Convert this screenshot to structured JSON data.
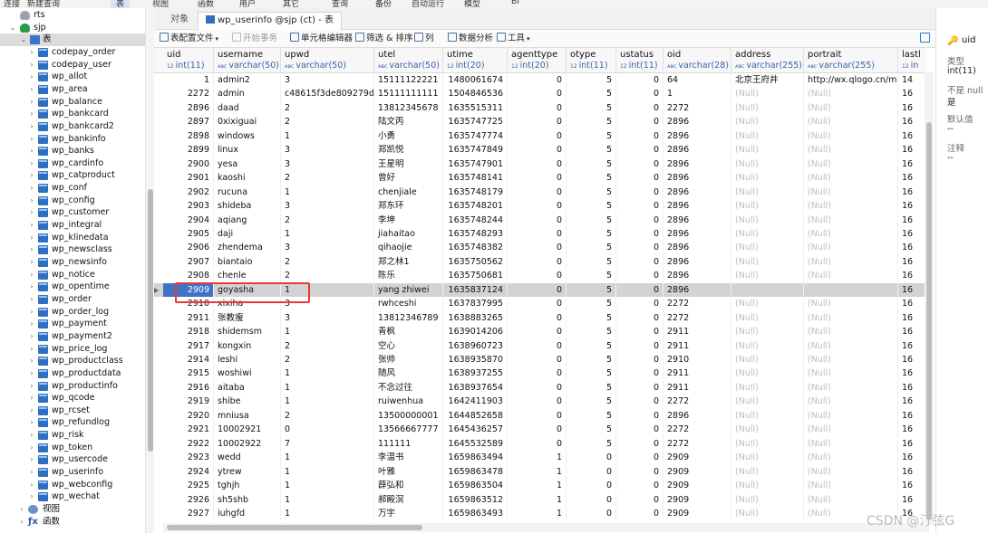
{
  "menubar": [
    "连接",
    "新建查询",
    "表",
    "视图",
    "函数",
    "用户",
    "其它",
    "查询",
    "备份",
    "自动运行",
    "模型",
    "BI"
  ],
  "sidebar": {
    "top_items": [
      {
        "label": "rts",
        "type": "db-closed"
      },
      {
        "label": "sjp",
        "type": "db-open"
      },
      {
        "label": "表",
        "type": "tables"
      }
    ],
    "tables": [
      "codepay_order",
      "codepay_user",
      "wp_allot",
      "wp_area",
      "wp_balance",
      "wp_bankcard",
      "wp_bankcard2",
      "wp_bankinfo",
      "wp_banks",
      "wp_cardinfo",
      "wp_catproduct",
      "wp_conf",
      "wp_config",
      "wp_customer",
      "wp_integral",
      "wp_klinedata",
      "wp_newsclass",
      "wp_newsinfo",
      "wp_notice",
      "wp_opentime",
      "wp_order",
      "wp_order_log",
      "wp_payment",
      "wp_payment2",
      "wp_price_log",
      "wp_productclass",
      "wp_productdata",
      "wp_productinfo",
      "wp_qcode",
      "wp_rcset",
      "wp_refundlog",
      "wp_risk",
      "wp_token",
      "wp_usercode",
      "wp_userinfo",
      "wp_webconfig",
      "wp_wechat"
    ],
    "bottom_items": [
      {
        "label": "视图",
        "type": "view"
      },
      {
        "label": "函数",
        "type": "fn"
      }
    ]
  },
  "tabs": [
    {
      "label": "对象"
    },
    {
      "label": "wp_userinfo @sjp (ct) - 表"
    }
  ],
  "toolbar": {
    "table_config": "表配置文件",
    "begin_tx": "开始事务",
    "cell_editor": "单元格编辑器",
    "filter_sort": "筛选 & 排序",
    "columns": "列",
    "data_analysis": "数据分析",
    "tools": "工具"
  },
  "columns": [
    {
      "name": "uid",
      "type": "int(11)"
    },
    {
      "name": "username",
      "type": "varchar(50)"
    },
    {
      "name": "upwd",
      "type": "varchar(50)"
    },
    {
      "name": "utel",
      "type": "varchar(50)"
    },
    {
      "name": "utime",
      "type": "int(20)"
    },
    {
      "name": "agenttype",
      "type": "int(20)"
    },
    {
      "name": "otype",
      "type": "int(11)"
    },
    {
      "name": "ustatus",
      "type": "int(11)"
    },
    {
      "name": "oid",
      "type": "varchar(28)"
    },
    {
      "name": "address",
      "type": "varchar(255)"
    },
    {
      "name": "portrait",
      "type": "varchar(255)"
    },
    {
      "name": "lastl",
      "type": "in"
    }
  ],
  "rows": [
    [
      "1",
      "admin2",
      "3",
      "15111122221",
      "1480061674",
      "0",
      "5",
      "0",
      "64",
      "北京王府井",
      "http://wx.qlogo.cn/mm",
      "14"
    ],
    [
      "2272",
      "admin",
      "c48615f3de809279d37e",
      "15111111111",
      "1504846536",
      "0",
      "5",
      "0",
      "1",
      "(Null)",
      "(Null)",
      "16"
    ],
    [
      "2896",
      "daad",
      "2",
      "13812345678",
      "1635515311",
      "0",
      "5",
      "0",
      "2272",
      "(Null)",
      "(Null)",
      "16"
    ],
    [
      "2897",
      "0xixiguai",
      "2",
      "陆文丙",
      "1635747725",
      "0",
      "5",
      "0",
      "2896",
      "(Null)",
      "(Null)",
      "16"
    ],
    [
      "2898",
      "windows",
      "1",
      "小勇",
      "1635747774",
      "0",
      "5",
      "0",
      "2896",
      "(Null)",
      "(Null)",
      "16"
    ],
    [
      "2899",
      "linux",
      "3",
      "郑凯悦",
      "1635747849",
      "0",
      "5",
      "0",
      "2896",
      "(Null)",
      "(Null)",
      "16"
    ],
    [
      "2900",
      "yesa",
      "3",
      "王星明",
      "1635747901",
      "0",
      "5",
      "0",
      "2896",
      "(Null)",
      "(Null)",
      "16"
    ],
    [
      "2901",
      "kaoshi",
      "2",
      "曾好",
      "1635748141",
      "0",
      "5",
      "0",
      "2896",
      "(Null)",
      "(Null)",
      "16"
    ],
    [
      "2902",
      "rucuna",
      "1",
      "chenjiale",
      "1635748179",
      "0",
      "5",
      "0",
      "2896",
      "(Null)",
      "(Null)",
      "16"
    ],
    [
      "2903",
      "shideba",
      "3",
      "郑东环",
      "1635748201",
      "0",
      "5",
      "0",
      "2896",
      "(Null)",
      "(Null)",
      "16"
    ],
    [
      "2904",
      "aqiang",
      "2",
      "李坤",
      "1635748244",
      "0",
      "5",
      "0",
      "2896",
      "(Null)",
      "(Null)",
      "16"
    ],
    [
      "2905",
      "daji",
      "1",
      "jiahaitao",
      "1635748293",
      "0",
      "5",
      "0",
      "2896",
      "(Null)",
      "(Null)",
      "16"
    ],
    [
      "2906",
      "zhendema",
      "3",
      "qihaojie",
      "1635748382",
      "0",
      "5",
      "0",
      "2896",
      "(Null)",
      "(Null)",
      "16"
    ],
    [
      "2907",
      "biantaio",
      "2",
      "郑之林1",
      "1635750562",
      "0",
      "5",
      "0",
      "2896",
      "(Null)",
      "(Null)",
      "16"
    ],
    [
      "2908",
      "chenle",
      "2",
      "陈乐",
      "1635750681",
      "0",
      "5",
      "0",
      "2896",
      "(Null)",
      "(Null)",
      "16"
    ],
    [
      "2909",
      "goyasha",
      "1",
      "yang zhiwei",
      "1635837124",
      "0",
      "5",
      "0",
      "2896",
      "",
      "",
      "16"
    ],
    [
      "2910",
      "xixiha",
      "3",
      "rwhceshi",
      "1637837995",
      "0",
      "5",
      "0",
      "2272",
      "(Null)",
      "(Null)",
      "16"
    ],
    [
      "2911",
      "张教瘦",
      "3",
      "13812346789",
      "1638883265",
      "0",
      "5",
      "0",
      "2272",
      "(Null)",
      "(Null)",
      "16"
    ],
    [
      "2918",
      "shidemsm",
      "1",
      "青枫",
      "1639014206",
      "0",
      "5",
      "0",
      "2911",
      "(Null)",
      "(Null)",
      "16"
    ],
    [
      "2917",
      "kongxin",
      "2",
      "空心",
      "1638960723",
      "0",
      "5",
      "0",
      "2911",
      "(Null)",
      "(Null)",
      "16"
    ],
    [
      "2914",
      "leshi",
      "2",
      "张帅",
      "1638935870",
      "0",
      "5",
      "0",
      "2910",
      "(Null)",
      "(Null)",
      "16"
    ],
    [
      "2915",
      "woshiwi",
      "1",
      "随风",
      "1638937255",
      "0",
      "5",
      "0",
      "2911",
      "(Null)",
      "(Null)",
      "16"
    ],
    [
      "2916",
      "aitaba",
      "1",
      "不念过往",
      "1638937654",
      "0",
      "5",
      "0",
      "2911",
      "(Null)",
      "(Null)",
      "16"
    ],
    [
      "2919",
      "shibe",
      "1",
      "ruiwenhua",
      "1642411903",
      "0",
      "5",
      "0",
      "2272",
      "(Null)",
      "(Null)",
      "16"
    ],
    [
      "2920",
      "mniusa",
      "2",
      "13500000001",
      "1644852658",
      "0",
      "5",
      "0",
      "2896",
      "(Null)",
      "(Null)",
      "16"
    ],
    [
      "2921",
      "10002921",
      "0",
      "13566667777",
      "1645436257",
      "0",
      "5",
      "0",
      "2272",
      "(Null)",
      "(Null)",
      "16"
    ],
    [
      "2922",
      "10002922",
      "7",
      "111111",
      "1645532589",
      "0",
      "5",
      "0",
      "2272",
      "(Null)",
      "(Null)",
      "16"
    ],
    [
      "2923",
      "wedd",
      "1",
      "李温书",
      "1659863494",
      "1",
      "0",
      "0",
      "2909",
      "(Null)",
      "(Null)",
      "16"
    ],
    [
      "2924",
      "ytrew",
      "1",
      "叶雅",
      "1659863478",
      "1",
      "0",
      "0",
      "2909",
      "(Null)",
      "(Null)",
      "16"
    ],
    [
      "2925",
      "tghjh",
      "1",
      "薛弘和",
      "1659863504",
      "1",
      "0",
      "0",
      "2909",
      "(Null)",
      "(Null)",
      "16"
    ],
    [
      "2926",
      "sh5shb",
      "1",
      "郝殿溟",
      "1659863512",
      "1",
      "0",
      "0",
      "2909",
      "(Null)",
      "(Null)",
      "16"
    ],
    [
      "2927",
      "iuhgfd",
      "1",
      "万宇",
      "1659863493",
      "1",
      "0",
      "0",
      "2909",
      "(Null)",
      "(Null)",
      "16"
    ]
  ],
  "selected_uid": "2909",
  "right_panel": {
    "field": "uid",
    "type_label": "类型",
    "type_value": "int(11)",
    "notnull_label": "不是 null",
    "notnull_value": "是",
    "default_label": "默认值",
    "default_value": "--",
    "comment_label": "注释",
    "comment_value": "--"
  },
  "watermark": "CSDN @汀弦G",
  "colors": {
    "selected_row": "#d3d3d3",
    "selected_cell": "#3f73c3",
    "highlight_box": "#e53a3a"
  }
}
